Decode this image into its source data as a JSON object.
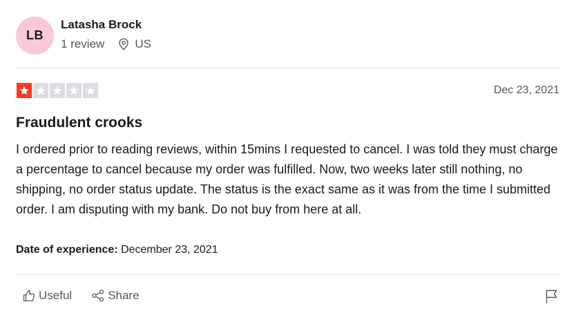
{
  "consumer": {
    "initials": "LB",
    "name": "Latasha Brock",
    "review_count": "1 review",
    "country": "US"
  },
  "review": {
    "rating": 1,
    "max_rating": 5,
    "date": "Dec 23, 2021",
    "title": "Fraudulent crooks",
    "body": "I ordered prior to reading reviews, within 15mins I requested to cancel. I was told they must charge a percentage to cancel because my order was fulfilled. Now, two weeks later still nothing, no shipping, no order status update. The status is the exact same as it was from the time I submitted order. I am disputing with my bank. Do not buy from here at all.",
    "experience_label": "Date of experience:",
    "experience_date": "December 23, 2021"
  },
  "actions": {
    "useful_label": "Useful",
    "share_label": "Share"
  },
  "icons": {
    "location": "location-pin-icon",
    "useful": "thumbs-up-icon",
    "share": "share-icon",
    "flag": "flag-icon",
    "star": "star-icon"
  },
  "colors": {
    "star_filled": "#ff3722",
    "star_empty": "#dcdce6",
    "avatar_bg": "#fac9d8"
  }
}
